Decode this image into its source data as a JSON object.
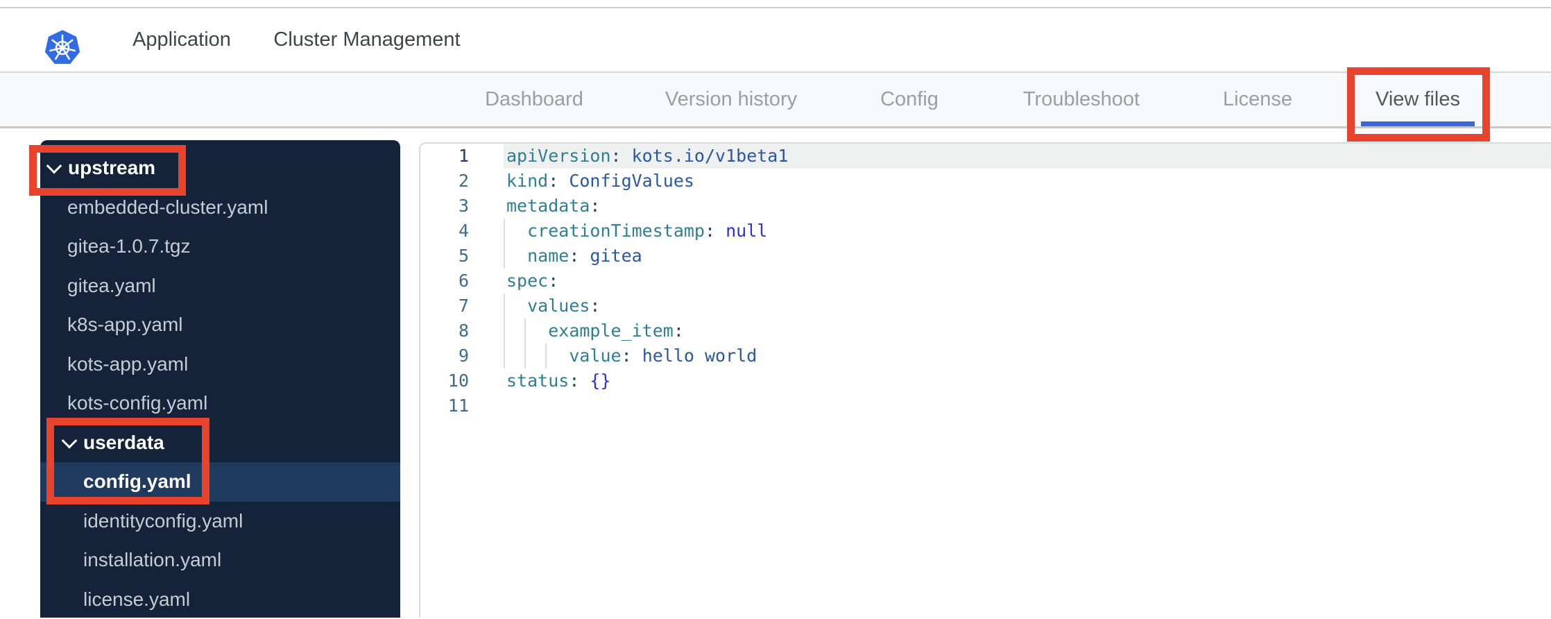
{
  "header": {
    "logo_name": "kubernetes-logo",
    "tabs": [
      {
        "label": "Application",
        "active": true
      },
      {
        "label": "Cluster Management",
        "active": false
      }
    ]
  },
  "nav": {
    "items": [
      {
        "label": "Dashboard",
        "active": false
      },
      {
        "label": "Version history",
        "active": false
      },
      {
        "label": "Config",
        "active": false
      },
      {
        "label": "Troubleshoot",
        "active": false
      },
      {
        "label": "License",
        "active": false
      },
      {
        "label": "View files",
        "active": true
      }
    ]
  },
  "tree": {
    "items": [
      {
        "label": "upstream",
        "type": "folder",
        "depth": 0,
        "expanded": true
      },
      {
        "label": "embedded-cluster.yaml",
        "type": "file",
        "depth": 1
      },
      {
        "label": "gitea-1.0.7.tgz",
        "type": "file",
        "depth": 1
      },
      {
        "label": "gitea.yaml",
        "type": "file",
        "depth": 1
      },
      {
        "label": "k8s-app.yaml",
        "type": "file",
        "depth": 1
      },
      {
        "label": "kots-app.yaml",
        "type": "file",
        "depth": 1
      },
      {
        "label": "kots-config.yaml",
        "type": "file",
        "depth": 1
      },
      {
        "label": "userdata",
        "type": "folder",
        "depth": 1,
        "expanded": true
      },
      {
        "label": "config.yaml",
        "type": "file",
        "depth": 2,
        "selected": true
      },
      {
        "label": "identityconfig.yaml",
        "type": "file",
        "depth": 2
      },
      {
        "label": "installation.yaml",
        "type": "file",
        "depth": 2
      },
      {
        "label": "license.yaml",
        "type": "file",
        "depth": 2
      }
    ]
  },
  "editor": {
    "file_shown": "config.yaml",
    "language": "yaml",
    "lines": [
      {
        "num": "1",
        "active": true,
        "indent": 0,
        "guides": 0,
        "tokens": [
          [
            "key",
            "apiVersion"
          ],
          [
            "pun",
            ": "
          ],
          [
            "str",
            "kots.io/v1beta1"
          ]
        ]
      },
      {
        "num": "2",
        "active": false,
        "indent": 0,
        "guides": 0,
        "tokens": [
          [
            "key",
            "kind"
          ],
          [
            "pun",
            ": "
          ],
          [
            "str",
            "ConfigValues"
          ]
        ]
      },
      {
        "num": "3",
        "active": false,
        "indent": 0,
        "guides": 0,
        "tokens": [
          [
            "key",
            "metadata"
          ],
          [
            "pun",
            ":"
          ]
        ]
      },
      {
        "num": "4",
        "active": false,
        "indent": 2,
        "guides": 1,
        "tokens": [
          [
            "key",
            "creationTimestamp"
          ],
          [
            "pun",
            ": "
          ],
          [
            "const",
            "null"
          ]
        ]
      },
      {
        "num": "5",
        "active": false,
        "indent": 2,
        "guides": 1,
        "tokens": [
          [
            "key",
            "name"
          ],
          [
            "pun",
            ": "
          ],
          [
            "str",
            "gitea"
          ]
        ]
      },
      {
        "num": "6",
        "active": false,
        "indent": 0,
        "guides": 0,
        "tokens": [
          [
            "key",
            "spec"
          ],
          [
            "pun",
            ":"
          ]
        ]
      },
      {
        "num": "7",
        "active": false,
        "indent": 2,
        "guides": 1,
        "tokens": [
          [
            "key",
            "values"
          ],
          [
            "pun",
            ":"
          ]
        ]
      },
      {
        "num": "8",
        "active": false,
        "indent": 4,
        "guides": 2,
        "tokens": [
          [
            "key",
            "example_item"
          ],
          [
            "pun",
            ":"
          ]
        ]
      },
      {
        "num": "9",
        "active": false,
        "indent": 6,
        "guides": 3,
        "tokens": [
          [
            "key",
            "value"
          ],
          [
            "pun",
            ": "
          ],
          [
            "str",
            "hello world"
          ]
        ]
      },
      {
        "num": "10",
        "active": false,
        "indent": 0,
        "guides": 0,
        "tokens": [
          [
            "key",
            "status"
          ],
          [
            "pun",
            ": "
          ],
          [
            "const",
            "{}"
          ]
        ]
      },
      {
        "num": "11",
        "active": false,
        "indent": 0,
        "guides": 0,
        "tokens": []
      }
    ]
  },
  "annotations": {
    "highlight_color": "#e8432c",
    "boxes": [
      "view-files-tab",
      "upstream-folder",
      "userdata-and-config-yaml"
    ]
  },
  "colors": {
    "accent_blue": "#3e68d8",
    "k8s_logo_blue": "#326ce5",
    "sidebar_bg": "#142339",
    "sidebar_selected_bg": "#1f3a5c",
    "syntax_key": "#2d7f93",
    "syntax_string": "#2a57a5",
    "syntax_constant": "#2b31de",
    "gutter_number": "#3e6b8e"
  }
}
